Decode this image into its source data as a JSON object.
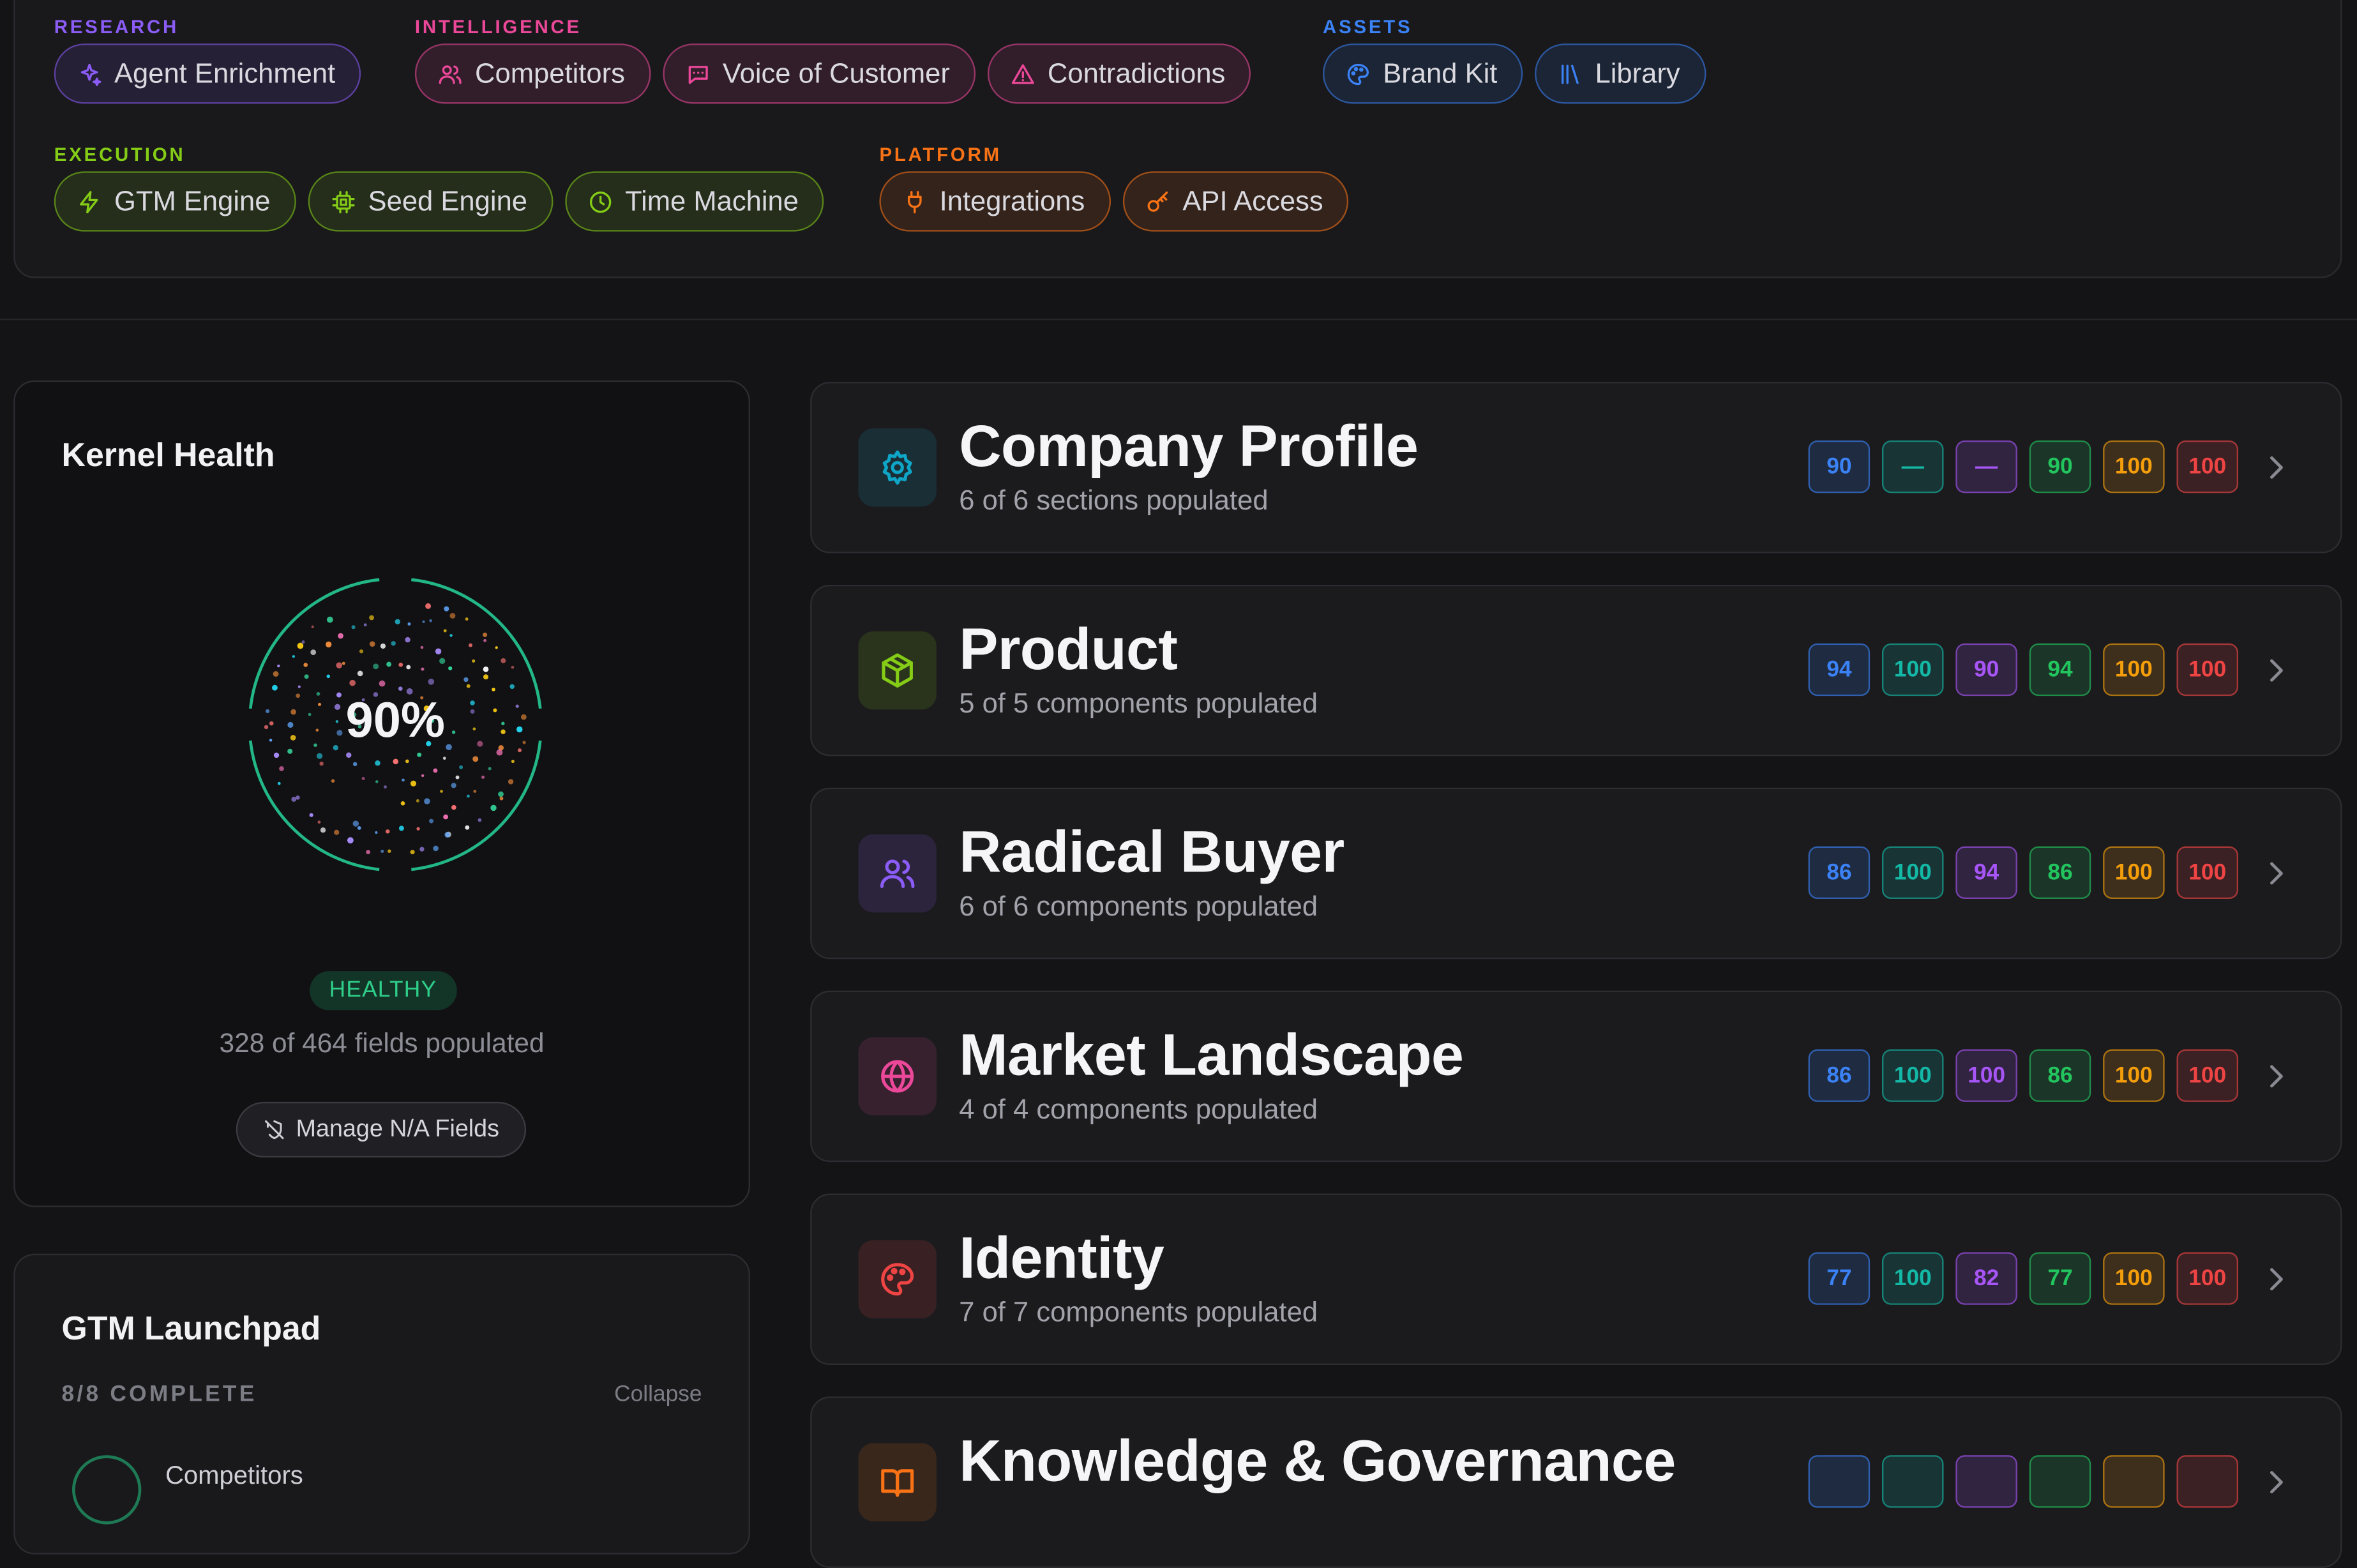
{
  "nav": {
    "groups": [
      {
        "title": "RESEARCH",
        "color": "#8b5cf6",
        "items": [
          {
            "label": "Agent Enrichment",
            "icon": "sparkles-icon"
          }
        ]
      },
      {
        "title": "INTELLIGENCE",
        "color": "#ec4899",
        "items": [
          {
            "label": "Competitors",
            "icon": "users-icon"
          },
          {
            "label": "Voice of Customer",
            "icon": "message-icon"
          },
          {
            "label": "Contradictions",
            "icon": "warning-icon"
          }
        ]
      },
      {
        "title": "ASSETS",
        "color": "#3b82f6",
        "items": [
          {
            "label": "Brand Kit",
            "icon": "palette-icon"
          },
          {
            "label": "Library",
            "icon": "library-icon"
          }
        ]
      },
      {
        "title": "EXECUTION",
        "color": "#84cc16",
        "items": [
          {
            "label": "GTM Engine",
            "icon": "bolt-icon"
          },
          {
            "label": "Seed Engine",
            "icon": "chip-icon"
          },
          {
            "label": "Time Machine",
            "icon": "clock-icon"
          }
        ]
      },
      {
        "title": "PLATFORM",
        "color": "#f97316",
        "items": [
          {
            "label": "Integrations",
            "icon": "plug-icon"
          },
          {
            "label": "API Access",
            "icon": "key-icon"
          }
        ]
      }
    ]
  },
  "kernel": {
    "title": "Kernel Health",
    "percent": "90%",
    "percent_value": 90,
    "status": "HEALTHY",
    "fields_text": "328 of 464 fields populated",
    "manage_label": "Manage N/A Fields"
  },
  "launchpad": {
    "title": "GTM Launchpad",
    "progress": "8/8 COMPLETE",
    "collapse_label": "Collapse",
    "first_item": "Competitors"
  },
  "score_colors": [
    "#3b82f6",
    "#14b8a6",
    "#a855f7",
    "#22c55e",
    "#f59e0b",
    "#ef4444"
  ],
  "rows": [
    {
      "title": "Company Profile",
      "subtitle": "6 of 6 sections populated",
      "icon": "gear-icon",
      "accent": "#0ea5c6",
      "scores": [
        "90",
        "—",
        "—",
        "90",
        "100",
        "100"
      ]
    },
    {
      "title": "Product",
      "subtitle": "5 of 5 components populated",
      "icon": "box-icon",
      "accent": "#84cc16",
      "scores": [
        "94",
        "100",
        "90",
        "94",
        "100",
        "100"
      ]
    },
    {
      "title": "Radical Buyer",
      "subtitle": "6 of 6 components populated",
      "icon": "users-icon",
      "accent": "#8b5cf6",
      "scores": [
        "86",
        "100",
        "94",
        "86",
        "100",
        "100"
      ]
    },
    {
      "title": "Market Landscape",
      "subtitle": "4 of 4 components populated",
      "icon": "globe-icon",
      "accent": "#ec4899",
      "scores": [
        "86",
        "100",
        "100",
        "86",
        "100",
        "100"
      ]
    },
    {
      "title": "Identity",
      "subtitle": "7 of 7 components populated",
      "icon": "palette-icon",
      "accent": "#ef4444",
      "scores": [
        "77",
        "100",
        "82",
        "77",
        "100",
        "100"
      ]
    },
    {
      "title": "Knowledge & Governance",
      "subtitle": "",
      "icon": "book-icon",
      "accent": "#f97316",
      "scores": [
        "",
        "",
        "",
        "",
        "",
        ""
      ]
    }
  ]
}
